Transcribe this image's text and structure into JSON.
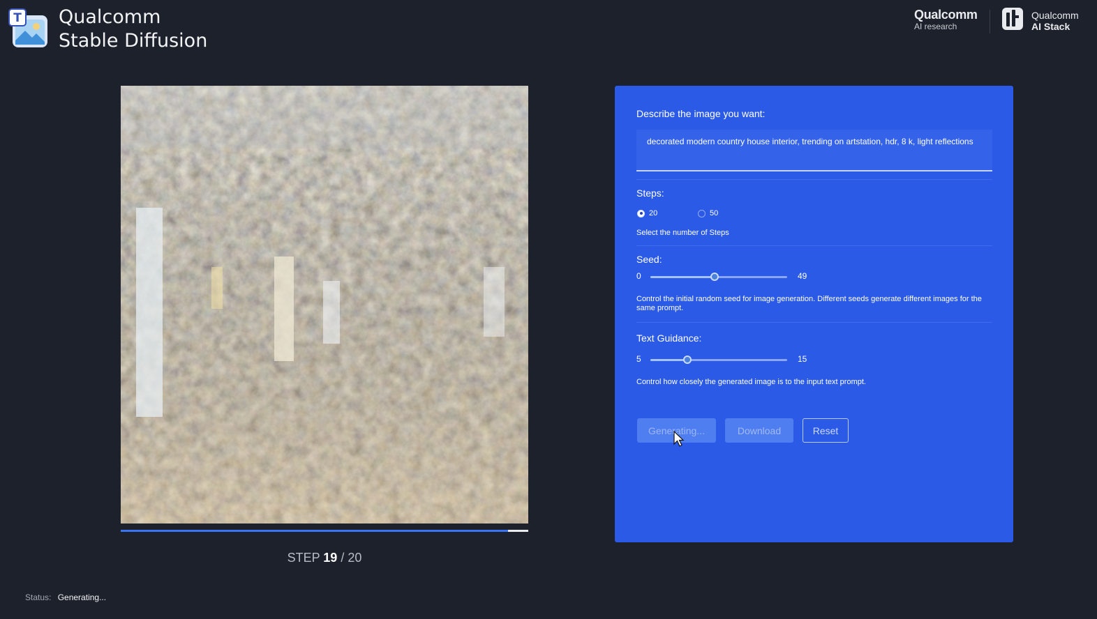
{
  "header": {
    "title_line1": "Qualcomm",
    "title_line2": "Stable Diffusion",
    "brand_research_name": "Qualcomm",
    "brand_research_sub": "AI research",
    "brand_stack_line1": "Qualcomm",
    "brand_stack_line2": "AI Stack"
  },
  "image": {
    "progress_fraction": 0.95,
    "step_label": "STEP",
    "step_current": "19",
    "step_separator": "/",
    "step_total": "20"
  },
  "status": {
    "label": "Status:",
    "value": "Generating..."
  },
  "panel": {
    "prompt_label": "Describe the image you want:",
    "prompt_text": "decorated modern country house interior, trending on artstation, hdr, 8 k, light reflections",
    "steps_label": "Steps:",
    "steps_options": [
      "20",
      "50"
    ],
    "steps_selected": "20",
    "steps_help": "Select the number of Steps",
    "seed_label": "Seed:",
    "seed_min": "0",
    "seed_max": "49",
    "seed_value": 23,
    "seed_help": "Control the initial random seed for image generation. Different seeds generate different images for the same prompt.",
    "guidance_label": "Text Guidance:",
    "guidance_min": "5",
    "guidance_max": "15",
    "guidance_value": 7.7,
    "guidance_help": "Control how closely the generated image is to the input text prompt.",
    "generate_label": "Generating...",
    "download_label": "Download",
    "reset_label": "Reset"
  },
  "colors": {
    "background": "#1d212b",
    "panel": "#2a5ae6",
    "progress": "#3b74f0"
  }
}
